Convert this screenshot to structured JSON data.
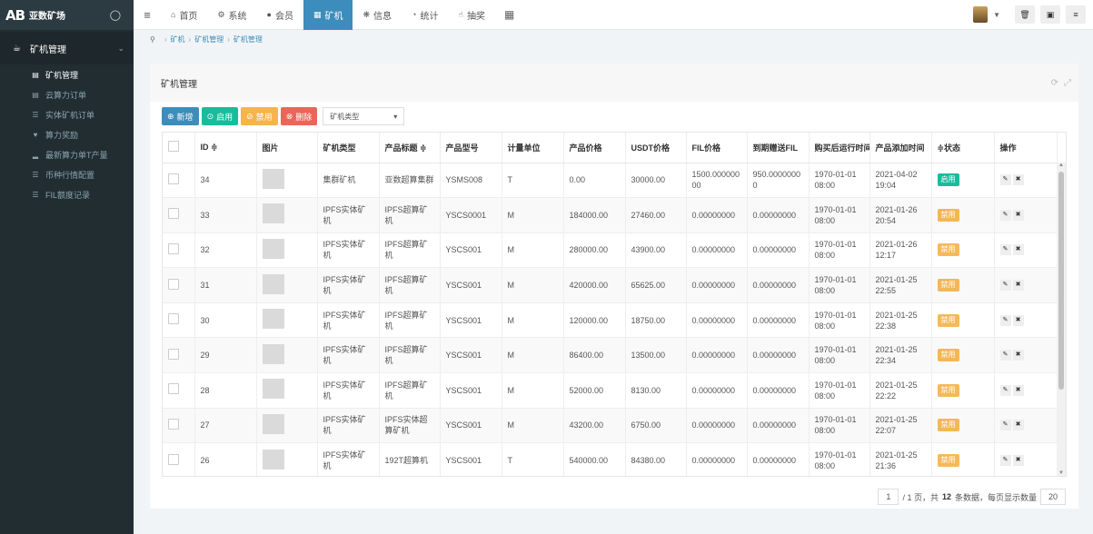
{
  "brand": {
    "mark": "AB",
    "name": "亚数矿场",
    "toggle_icon": "droplet-icon"
  },
  "sidebar": {
    "section": {
      "label": "矿机管理",
      "icon": "cup-icon"
    },
    "items": [
      {
        "label": "矿机管理",
        "icon": "monitor-icon",
        "active": true
      },
      {
        "label": "云算力订单",
        "icon": "chart-icon"
      },
      {
        "label": "实体矿机订单",
        "icon": "list-icon"
      },
      {
        "label": "算力奖励",
        "icon": "heart-icon"
      },
      {
        "label": "最新算力单T产量",
        "icon": "bar-icon"
      },
      {
        "label": "币种行情配置",
        "icon": "list-icon"
      },
      {
        "label": "FIL额度记录",
        "icon": "list-icon"
      }
    ]
  },
  "topnav": [
    {
      "label": "首页",
      "icon": "home-icon"
    },
    {
      "label": "系统",
      "icon": "gear-icon"
    },
    {
      "label": "会员",
      "icon": "user-icon"
    },
    {
      "label": "矿机",
      "icon": "windows-icon",
      "active": true
    },
    {
      "label": "信息",
      "icon": "graph-icon"
    },
    {
      "label": "统计",
      "icon": "pie-icon"
    },
    {
      "label": "抽奖",
      "icon": "hand-icon"
    }
  ],
  "breadcrumb": [
    "矿机",
    "矿机管理",
    "矿机管理"
  ],
  "panel": {
    "title": "矿机管理"
  },
  "toolbar": {
    "add": "新增",
    "enable": "启用",
    "disable": "禁用",
    "delete": "删除",
    "filter_placeholder": "矿机类型"
  },
  "table": {
    "headers": [
      "ID ≑",
      "图片",
      "矿机类型",
      "产品标题 ≑",
      "产品型号",
      "计量单位",
      "产品价格",
      "USDT价格",
      "FIL价格",
      "到期赠送FIL",
      "购买后运行时间",
      "产品添加时间",
      "≑状态",
      "操作"
    ],
    "rows": [
      {
        "id": "34",
        "type": "集群矿机",
        "title": "亚数超算集群",
        "model": "YSMS008",
        "unit": "T",
        "price": "0.00",
        "usdt": "30000.00",
        "fil": "1500.000000 00",
        "gift": "950.0000000 0",
        "run": "1970-01-01 08:00",
        "added": "2021-04-02 19:04",
        "status": "启用",
        "on": true
      },
      {
        "id": "33",
        "type": "IPFS实体矿机",
        "title": "IPFS超算矿机",
        "model": "YSCS0001",
        "unit": "M",
        "price": "184000.00",
        "usdt": "27460.00",
        "fil": "0.00000000",
        "gift": "0.00000000",
        "run": "1970-01-01 08:00",
        "added": "2021-01-26 20:54",
        "status": "禁用",
        "on": false
      },
      {
        "id": "32",
        "type": "IPFS实体矿机",
        "title": "IPFS超算矿机",
        "model": "YSCS001",
        "unit": "M",
        "price": "280000.00",
        "usdt": "43900.00",
        "fil": "0.00000000",
        "gift": "0.00000000",
        "run": "1970-01-01 08:00",
        "added": "2021-01-26 12:17",
        "status": "禁用",
        "on": false
      },
      {
        "id": "31",
        "type": "IPFS实体矿机",
        "title": "IPFS超算矿机",
        "model": "YSCS001",
        "unit": "M",
        "price": "420000.00",
        "usdt": "65625.00",
        "fil": "0.00000000",
        "gift": "0.00000000",
        "run": "1970-01-01 08:00",
        "added": "2021-01-25 22:55",
        "status": "禁用",
        "on": false
      },
      {
        "id": "30",
        "type": "IPFS实体矿机",
        "title": "IPFS超算矿机",
        "model": "YSCS001",
        "unit": "M",
        "price": "120000.00",
        "usdt": "18750.00",
        "fil": "0.00000000",
        "gift": "0.00000000",
        "run": "1970-01-01 08:00",
        "added": "2021-01-25 22:38",
        "status": "禁用",
        "on": false
      },
      {
        "id": "29",
        "type": "IPFS实体矿机",
        "title": "IPFS超算矿机",
        "model": "YSCS001",
        "unit": "M",
        "price": "86400.00",
        "usdt": "13500.00",
        "fil": "0.00000000",
        "gift": "0.00000000",
        "run": "1970-01-01 08:00",
        "added": "2021-01-25 22:34",
        "status": "禁用",
        "on": false
      },
      {
        "id": "28",
        "type": "IPFS实体矿机",
        "title": "IPFS超算矿机",
        "model": "YSCS001",
        "unit": "M",
        "price": "52000.00",
        "usdt": "8130.00",
        "fil": "0.00000000",
        "gift": "0.00000000",
        "run": "1970-01-01 08:00",
        "added": "2021-01-25 22:22",
        "status": "禁用",
        "on": false
      },
      {
        "id": "27",
        "type": "IPFS实体矿机",
        "title": "IPFS实体超算矿机",
        "model": "YSCS001",
        "unit": "M",
        "price": "43200.00",
        "usdt": "6750.00",
        "fil": "0.00000000",
        "gift": "0.00000000",
        "run": "1970-01-01 08:00",
        "added": "2021-01-25 22:07",
        "status": "禁用",
        "on": false
      },
      {
        "id": "26",
        "type": "IPFS实体矿机",
        "title": "192T超算机",
        "model": "YSCS001",
        "unit": "T",
        "price": "540000.00",
        "usdt": "84380.00",
        "fil": "0.00000000",
        "gift": "0.00000000",
        "run": "1970-01-01 08:00",
        "added": "2021-01-25 21:36",
        "status": "禁用",
        "on": false
      }
    ]
  },
  "pager": {
    "page": "1",
    "pages_text": "/ 1 页，共",
    "total": "12",
    "total_suffix": "条数据，每页显示数量",
    "per_page": "20"
  }
}
